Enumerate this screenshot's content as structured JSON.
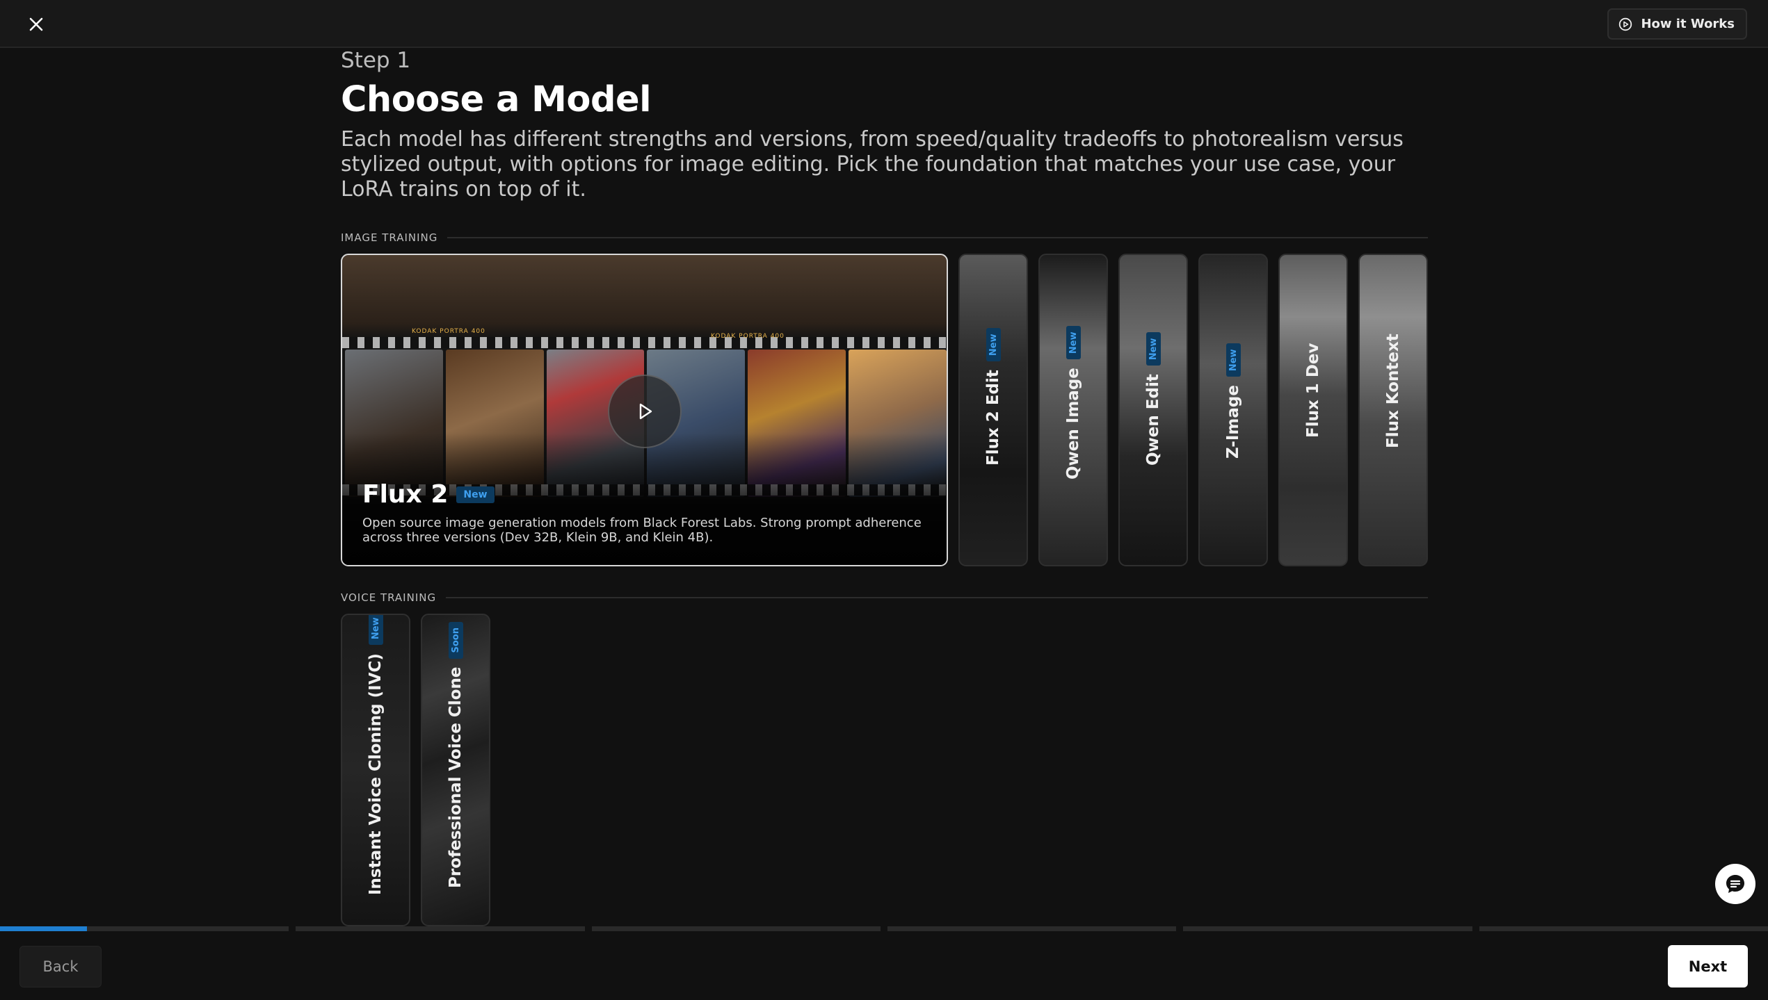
{
  "header": {
    "how_it_works_label": "How it Works"
  },
  "main": {
    "step_label": "Step 1",
    "title": "Choose a Model",
    "description": "Each model has different strengths and versions, from speed/quality tradeoffs to photorealism versus stylized output, with options for image editing. Pick the foundation that matches your use case, your LoRA trains on top of it."
  },
  "image_training": {
    "heading": "IMAGE TRAINING",
    "featured": {
      "name": "Flux 2",
      "badge": "New",
      "description": "Open source image generation models from Black Forest Labs. Strong prompt adherence across three versions (Dev 32B, Klein 9B, and Klein 4B).",
      "film_text": "KODAK PORTRA 400"
    },
    "models": [
      {
        "name": "Flux 2 Edit",
        "badge": "New"
      },
      {
        "name": "Qwen Image",
        "badge": "New"
      },
      {
        "name": "Qwen Edit",
        "badge": "New"
      },
      {
        "name": "Z-Image",
        "badge": "New"
      },
      {
        "name": "Flux 1 Dev",
        "badge": ""
      },
      {
        "name": "Flux Kontext",
        "badge": ""
      }
    ]
  },
  "voice_training": {
    "heading": "VOICE TRAINING",
    "models": [
      {
        "name": "Instant Voice Cloning (IVC)",
        "badge": "New"
      },
      {
        "name": "Professional Voice Clone",
        "badge": "Soon"
      }
    ]
  },
  "progress": {
    "total_steps": 6,
    "current_step": 1,
    "current_step_fill": 0.3
  },
  "footer": {
    "back_label": "Back",
    "next_label": "Next"
  },
  "colors": {
    "accent": "#1f7fd1",
    "badge_bg": "#0c3a5e",
    "badge_text": "#3fa0f0",
    "background": "#111111"
  },
  "icons": [
    "close-icon",
    "play-circle-icon",
    "play-icon",
    "chat-icon"
  ]
}
